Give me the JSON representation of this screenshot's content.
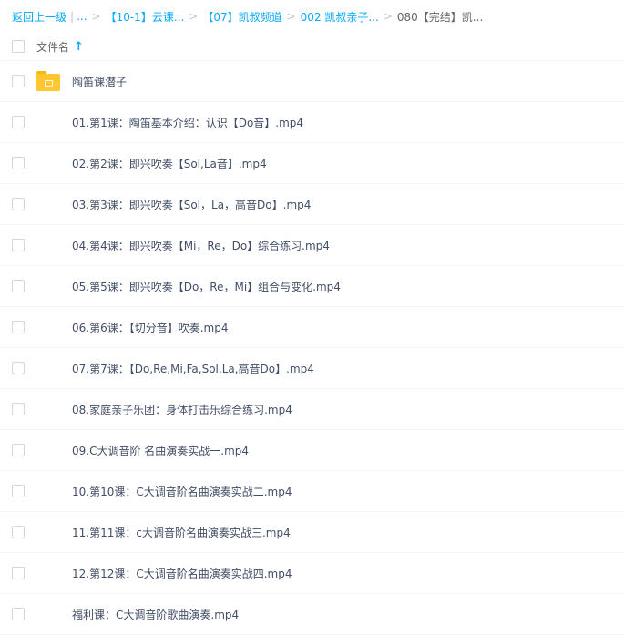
{
  "breadcrumb": {
    "back_label": "返回上一级",
    "ellipsis": "...",
    "items": [
      "【10-1】云课...",
      "【07】凯叔频道",
      "002 凯叔亲子...",
      "080【完结】凯..."
    ],
    "separator": ">",
    "bar": "|"
  },
  "header": {
    "column_label": "文件名",
    "sort_icon": "arrow-up-icon",
    "sort_glyph": "↑"
  },
  "colors": {
    "accent": "#09aaff",
    "video_icon": "#7b6cf0",
    "folder_icon": "#ffc62f"
  },
  "files": [
    {
      "type": "folder",
      "name": "陶笛课潜子"
    },
    {
      "type": "video",
      "name": "01.第1课：陶笛基本介绍：认识【Do音】.mp4"
    },
    {
      "type": "video",
      "name": "02.第2课：即兴吹奏【Sol,La音】.mp4"
    },
    {
      "type": "video",
      "name": "03.第3课：即兴吹奏【Sol，La，高音Do】.mp4"
    },
    {
      "type": "video",
      "name": "04.第4课：即兴吹奏【Mi，Re，Do】综合练习.mp4"
    },
    {
      "type": "video",
      "name": "05.第5课：即兴吹奏【Do，Re，Mi】组合与变化.mp4"
    },
    {
      "type": "video",
      "name": "06.第6课：【切分音】吹奏.mp4"
    },
    {
      "type": "video",
      "name": "07.第7课：【Do,Re,Mi,Fa,Sol,La,高音Do】.mp4"
    },
    {
      "type": "video",
      "name": "08.家庭亲子乐团：身体打击乐综合练习.mp4"
    },
    {
      "type": "video",
      "name": "09.C大调音阶 名曲演奏实战一.mp4"
    },
    {
      "type": "video",
      "name": "10.第10课：C大调音阶名曲演奏实战二.mp4"
    },
    {
      "type": "video",
      "name": "11.第11课：c大调音阶名曲演奏实战三.mp4"
    },
    {
      "type": "video",
      "name": "12.第12课：C大调音阶名曲演奏实战四.mp4"
    },
    {
      "type": "video",
      "name": "福利课：C大调音阶歌曲演奏.mp4"
    }
  ]
}
